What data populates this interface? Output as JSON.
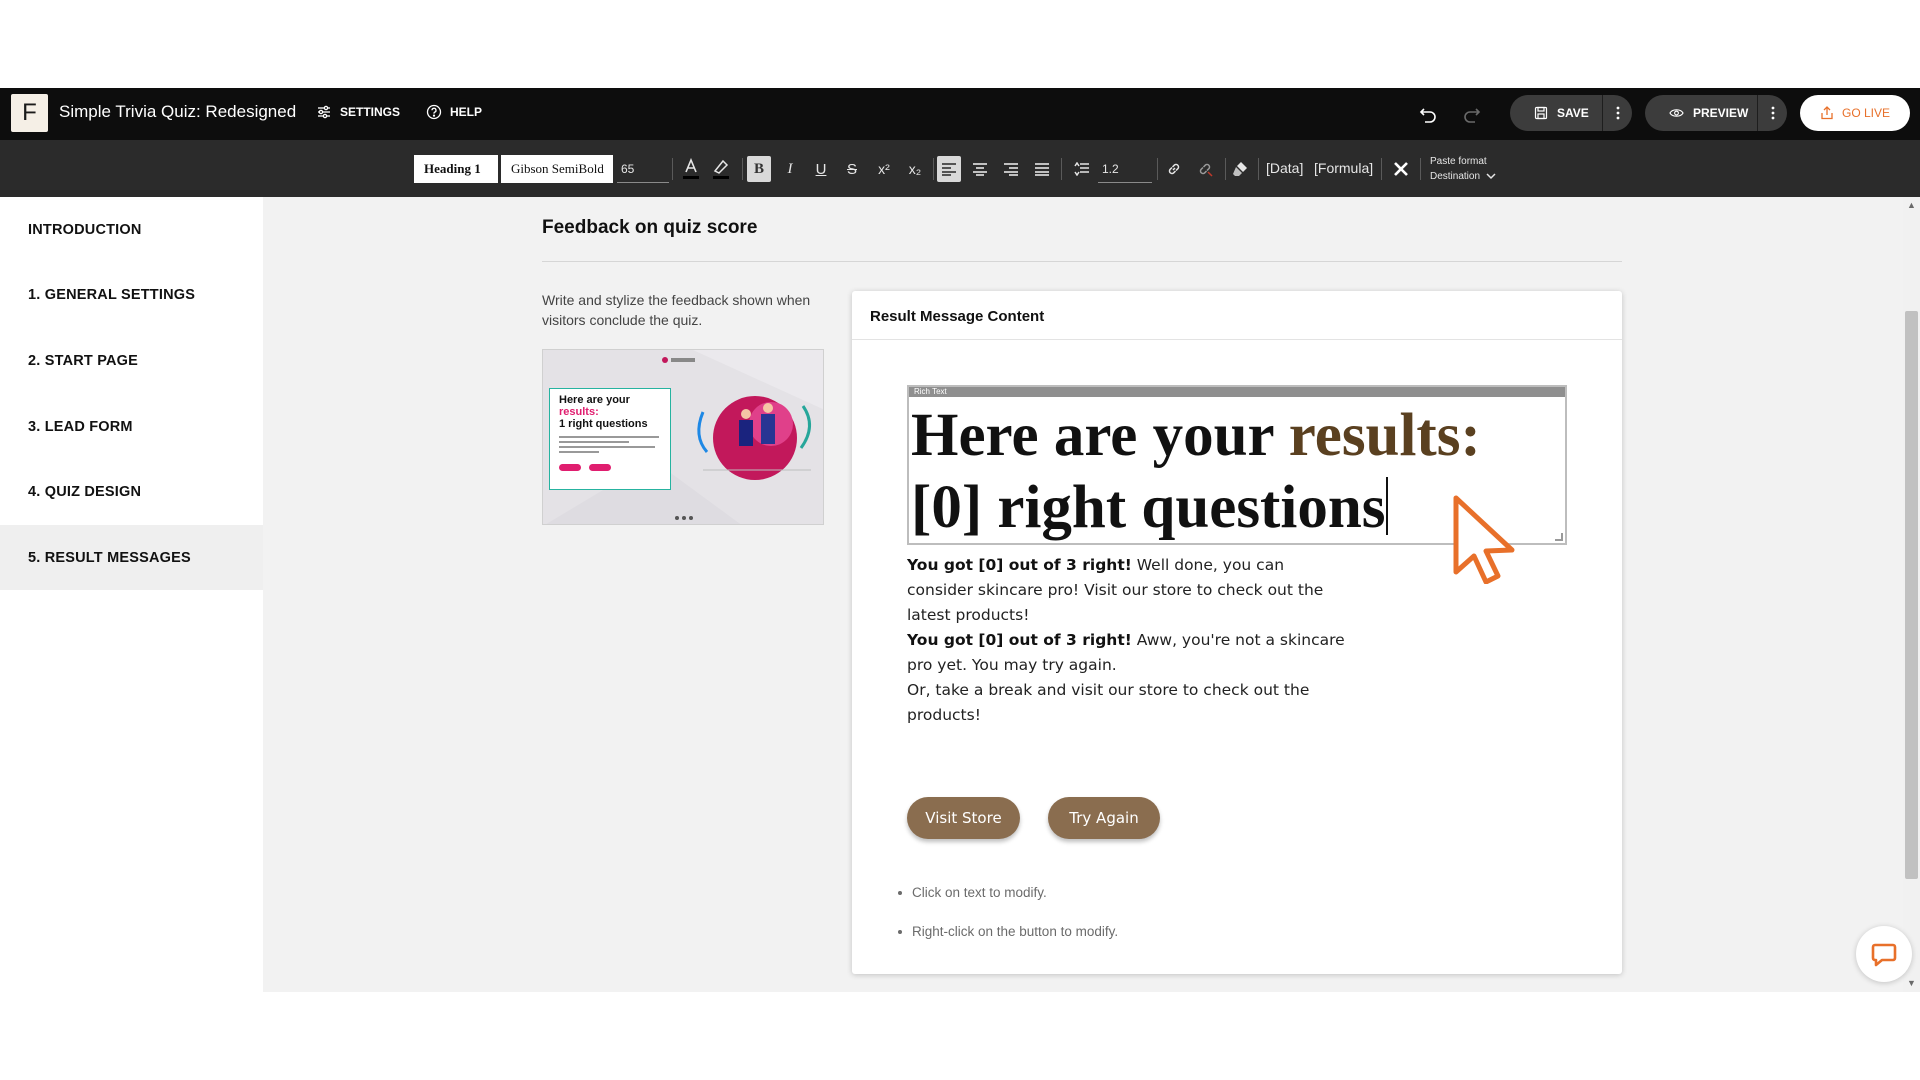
{
  "app": {
    "logo_letter": "F",
    "title": "Simple Trivia Quiz: Redesigned",
    "settings_label": "SETTINGS",
    "help_label": "HELP",
    "save_label": "SAVE",
    "preview_label": "PREVIEW",
    "golive_label": "GO LIVE"
  },
  "toolbar": {
    "block_format": "Heading 1",
    "font_family": "Gibson SemiBold",
    "font_size": "65",
    "line_height": "1.2",
    "data_label": "[Data]",
    "formula_label": "[Formula]",
    "paste_format_line1": "Paste format",
    "paste_format_line2": "Destination",
    "bold": "B",
    "italic": "I",
    "underline": "U",
    "strike": "S",
    "superscript": "x²",
    "subscript": "x₂"
  },
  "sidebar": {
    "items": [
      {
        "label": "INTRODUCTION"
      },
      {
        "label": "1. GENERAL SETTINGS"
      },
      {
        "label": "2. START PAGE"
      },
      {
        "label": "3. LEAD FORM"
      },
      {
        "label": "4. QUIZ DESIGN"
      },
      {
        "label": "5. RESULT MESSAGES"
      }
    ],
    "active_index": 5
  },
  "main": {
    "section_title": "Feedback on quiz score",
    "description": "Write and stylize the feedback shown when visitors conclude the quiz.",
    "thumbnail": {
      "line1": "Here are your",
      "line2": "results:",
      "line3": "1 right questions"
    },
    "card": {
      "title": "Result Message Content",
      "rich_text_label": "Rich Text",
      "heading_part1": "Here are your ",
      "heading_highlight": "results:",
      "heading_line2": "[0] right questions",
      "msg1_bold": "You got [0] out of 3 right!",
      "msg1_text": " Well done, you can consider skincare pro! Visit our store to check out the latest products!",
      "msg2_bold": "You got [0] out of 3 right!",
      "msg2_text": " Aww, you're not a skincare pro yet. You may try again.",
      "msg2_line2": "Or, take a break and visit our store to check out the products!",
      "button1": "Visit Store",
      "button2": "Try Again",
      "tips": [
        "Click on text to modify.",
        "Right-click on the button to modify."
      ]
    }
  },
  "colors": {
    "accent": "#e8702a",
    "button_brown": "#8a6d4f",
    "highlight_text": "#5a4020",
    "topbar_bg": "#0d0d0d",
    "toolbar_bg": "#2b2b2b"
  }
}
